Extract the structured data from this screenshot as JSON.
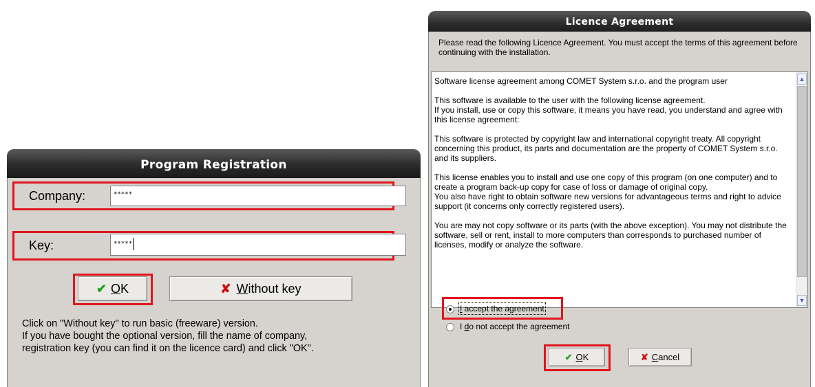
{
  "registration": {
    "title": "Program Registration",
    "company_label": "Company:",
    "company_value": "*****",
    "key_label": "Key:",
    "key_value": "*****",
    "ok_accel": "O",
    "ok_rest": "K",
    "without_key_accel": "W",
    "without_key_rest": "ithout key",
    "help_lines": [
      "Click on \"Without key\" to run basic (freeware) version.",
      "If you have bought the optional version, fill the name of company,",
      "registration key  (you can find it on the licence card) and click \"OK\"."
    ]
  },
  "licence": {
    "title": "Licence Agreement",
    "intro": "Please read the following Licence Agreement. You must accept the terms of this agreement before continuing with the installation.",
    "paragraphs": [
      "Software license agreement among COMET System s.r.o. and the program user",
      "This software is available to the user with the following license agreement.\nIf you install, use or copy this software, it means you have read, you understand and agree with this license agreement:",
      "This software is protected by copyright law and international copyright treaty. All copyright concerning this product, its parts and documentation are the property of  COMET System s.r.o. and its suppliers.",
      "This license enables you to install and use one copy of this program (on one computer) and to create a program back-up copy for case of loss or damage of original copy.\nYou also have right to obtain software new versions for advantageous terms and right to advice support   (it concerns only correctly registered users).",
      "You are may not copy software or its parts (with the above exception). You may not distribute the software, sell or rent, install to more computers than corresponds to purchased number of licenses, modify or analyze the software."
    ],
    "accept_accel": "I",
    "accept_pre": "",
    "accept_rest": " accept the agreement",
    "decline_pre": "I ",
    "decline_accel": "d",
    "decline_rest": "o not accept the agreement",
    "selected_option": "accept",
    "ok_accel": "O",
    "ok_rest": "K",
    "cancel_accel": "C",
    "cancel_rest": "ancel"
  },
  "icons": {
    "ok": "check-icon",
    "cancel": "cross-icon",
    "scroll_up": "scroll-up-arrow-icon",
    "scroll_down": "scroll-down-arrow-icon"
  },
  "colors": {
    "highlight_red": "#e0141e",
    "check_green": "#1fa21f",
    "cross_red": "#d01010",
    "dialog_gray": "#d6d3ce"
  }
}
